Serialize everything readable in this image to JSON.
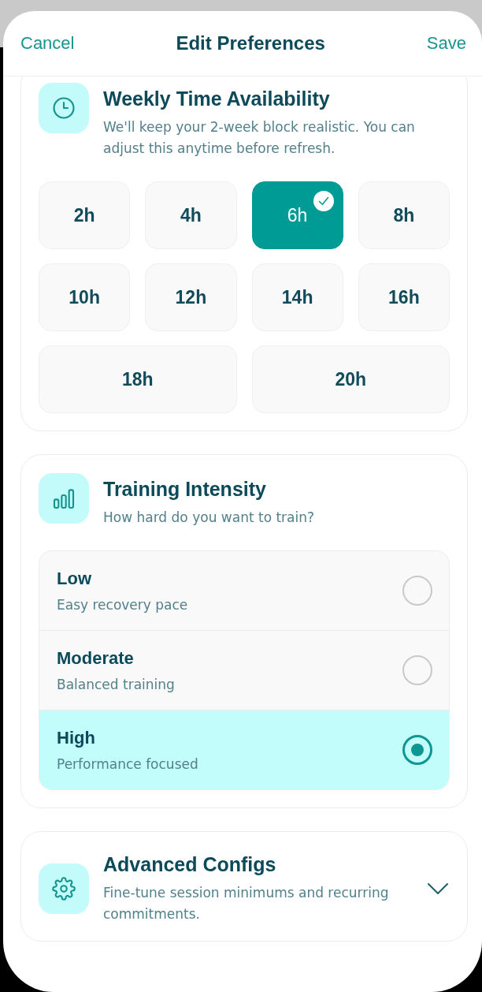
{
  "header": {
    "cancel": "Cancel",
    "title": "Edit Preferences",
    "save": "Save"
  },
  "sections": [
    {
      "kind": "hours",
      "title": "Weekly Time Availability",
      "subtitle": "We'll keep your 2-week block realistic. You can adjust this anytime before refresh.",
      "options": [
        {
          "label": "2h",
          "selected": false
        },
        {
          "label": "4h",
          "selected": false
        },
        {
          "label": "6h",
          "selected": true
        },
        {
          "label": "8h",
          "selected": false
        },
        {
          "label": "10h",
          "selected": false
        },
        {
          "label": "12h",
          "selected": false
        },
        {
          "label": "14h",
          "selected": false
        },
        {
          "label": "16h",
          "selected": false
        },
        {
          "label": "18h",
          "selected": false
        },
        {
          "label": "20h",
          "selected": false
        }
      ]
    },
    {
      "kind": "intensity",
      "title": "Training Intensity",
      "subtitle": "How hard do you want to train?",
      "options": [
        {
          "label": "Low",
          "description": "Easy recovery pace",
          "selected": false
        },
        {
          "label": "Moderate",
          "description": "Balanced training",
          "selected": false
        },
        {
          "label": "High",
          "description": "Performance focused",
          "selected": true
        }
      ]
    },
    {
      "kind": "collapsible",
      "title": "Advanced Configs",
      "subtitle": "Fine-tune session minimums and recurring commitments.",
      "expanded": false
    }
  ]
}
